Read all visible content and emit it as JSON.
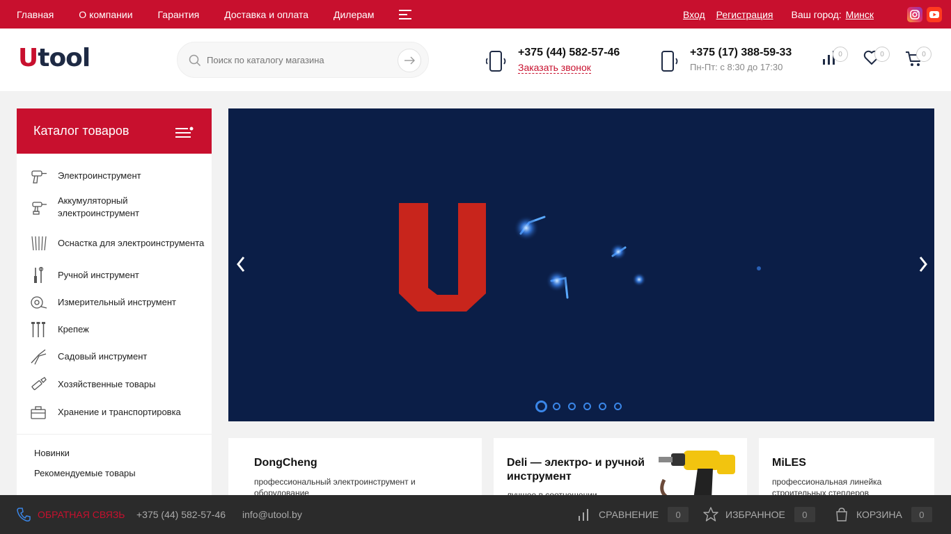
{
  "topbar": {
    "nav": [
      "Главная",
      "О компании",
      "Гарантия",
      "Доставка и оплата",
      "Дилерам"
    ],
    "login": "Вход",
    "register": "Регистрация",
    "city_label": "Ваш город:",
    "city": "Минск",
    "accent_color": "#c8102e"
  },
  "header": {
    "logo_u": "U",
    "logo_rest": "tool",
    "search_placeholder": "Поиск по каталогу магазина",
    "phone1": "+375 (44) 582-57-46",
    "callback": "Заказать звонок",
    "phone2": "+375 (17) 388-59-33",
    "hours": "Пн-Пт: с 8:30 до 17:30",
    "compare_count": "0",
    "favorites_count": "0",
    "cart_count": "0"
  },
  "catalog": {
    "title": "Каталог товаров",
    "items": [
      {
        "label": "Электроинструмент",
        "icon": "drill-icon"
      },
      {
        "label": "Аккумуляторный электроинструмент",
        "icon": "cordless-drill-icon"
      },
      {
        "label": "Оснастка для электроинструмента",
        "icon": "drill-bits-icon"
      },
      {
        "label": "Ручной инструмент",
        "icon": "hand-tools-icon"
      },
      {
        "label": "Измерительный инструмент",
        "icon": "tape-measure-icon"
      },
      {
        "label": "Крепеж",
        "icon": "fasteners-icon"
      },
      {
        "label": "Садовый инструмент",
        "icon": "pruner-icon"
      },
      {
        "label": "Хозяйственные товары",
        "icon": "flashlight-icon"
      },
      {
        "label": "Хранение и транспортировка",
        "icon": "toolbox-icon"
      }
    ],
    "extra": [
      "Новинки",
      "Рекомендуемые товары"
    ]
  },
  "banner": {
    "slides": 6,
    "active_slide": 1,
    "background": "#0b1e47"
  },
  "cards": [
    {
      "title": "DongCheng",
      "desc": "профессиональный электроинструмент и оборудование"
    },
    {
      "title": "Deli — электро- и ручной инструмент",
      "desc": "лучшее в соотношении"
    },
    {
      "title": "MiLES",
      "desc": "профессиональная линейка строительных степлеров"
    }
  ],
  "bottombar": {
    "feedback": "ОБРАТНАЯ СВЯЗЬ",
    "phone": "+375 (44) 582-57-46",
    "email": "info@utool.by",
    "compare": "СРАВНЕНИЕ",
    "compare_count": "0",
    "favorites": "ИЗБРАННОЕ",
    "favorites_count": "0",
    "cart": "КОРЗИНА",
    "cart_count": "0"
  }
}
